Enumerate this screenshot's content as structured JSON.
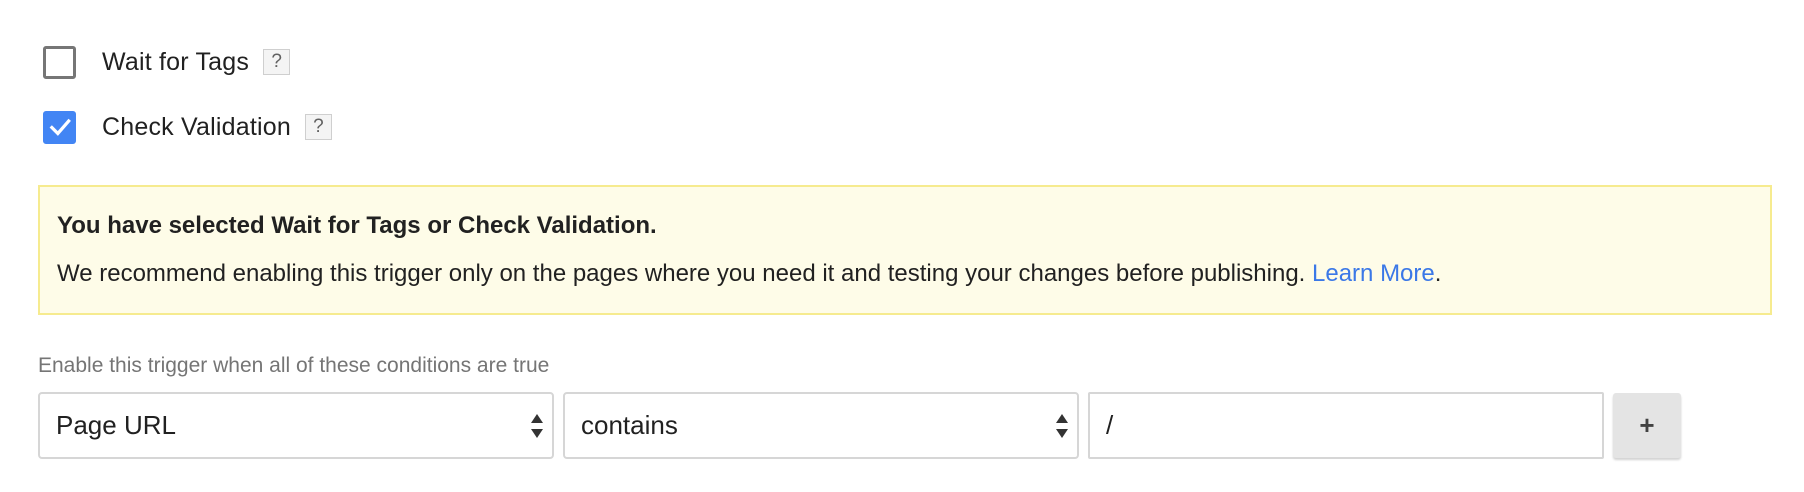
{
  "checkboxes": {
    "wait_for_tags": {
      "label": "Wait for Tags",
      "checked": false,
      "help": "?"
    },
    "check_validation": {
      "label": "Check Validation",
      "checked": true,
      "help": "?"
    }
  },
  "alert": {
    "title": "You have selected Wait for Tags or Check Validation.",
    "body": "We recommend enabling this trigger only on the pages where you need it and testing your changes before publishing. ",
    "link": "Learn More",
    "trailing": ".",
    "colors": {
      "background": "#fefce8",
      "border": "#f6eb8f",
      "link": "#3b78e7"
    }
  },
  "conditions": {
    "label": "Enable this trigger when all of these conditions are true",
    "variable": "Page URL",
    "operator": "contains",
    "value": "/",
    "add_label": "+"
  },
  "colors": {
    "checkbox_checked": "#4285f4"
  },
  "icons": {
    "checkmark": "checkmark-icon",
    "select_arrows": "select-arrows-icon"
  }
}
